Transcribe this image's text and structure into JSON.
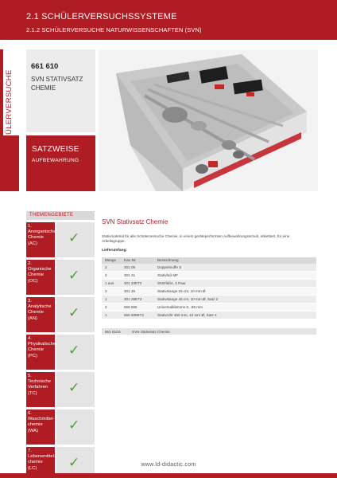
{
  "header": {
    "title": "2.1 SCHÜLERVERSUCHSSYSTEME",
    "subtitle": "2.1.2 SCHÜLERVERSUCHE NATURWISSENSCHAFTEN (SVN)"
  },
  "side_tab": {
    "label": "CHEMIE - SCHÜLERVERSUCHE"
  },
  "product": {
    "number": "661 610",
    "name": "SVN STATIVSATZ CHEMIE"
  },
  "set_box": {
    "title": "SATZWEISE",
    "subtitle": "AUFBEWAHRUNG"
  },
  "themes": {
    "header": "THEMENGEBIETE",
    "items": [
      {
        "label": "1.\nAnorganische\nChemie\n(AC)",
        "check": "✓"
      },
      {
        "label": "2.\nOrganische\nChemie\n(OC)",
        "check": "✓"
      },
      {
        "label": "3.\nAnalytische\nChemie\n(AN)",
        "check": "✓"
      },
      {
        "label": "4.\nPhysikalische\nChemie\n(PC)",
        "check": "✓"
      },
      {
        "label": "5.\nTechnische\nVerfahren\n(TC)",
        "check": "✓"
      },
      {
        "label": "6.\nWaschmittel-\nchemie\n(WA)",
        "check": "✓"
      },
      {
        "label": "7.\nLebensmittel-\nchemie\n(LC)",
        "check": "✓"
      }
    ]
  },
  "content": {
    "title": "SVN Stativsatz Chemie",
    "description": "Stativmaterial für alle Schülerversuche Chemie, in einem geräteperformten Aufbewahrungsschub, etikettiert, für eine Arbeitsgruppe.",
    "lieferumfang": "Lieferumfang:",
    "columns": [
      "Menge",
      "Kat.-Nr.",
      "Bezeichnung"
    ],
    "rows": [
      [
        "2",
        "301 09",
        "Doppelmuffe S"
      ],
      [
        "2",
        "301 21",
        "Stativfuß MF"
      ],
      [
        "1 aus",
        "301 23ET2",
        "Stützfüße, 2 Paar"
      ],
      [
        "2",
        "301 26",
        "Stativstange 25 cm, 10 mm Ø"
      ],
      [
        "1",
        "301 28ET2",
        "Stativstange 45 cm, 10 mm Ø, Satz 2"
      ],
      [
        "2",
        "666 555",
        "Universalklemme 0...80 mm"
      ],
      [
        "1",
        "666 609ET2",
        "Stativrohr 450 mm, 10 mm Ø, Satz 2"
      ]
    ],
    "order": {
      "number": "661 610S",
      "name": "SVN Stativsatz Chemie"
    }
  },
  "footer": {
    "url": "www.ld-didactic.com"
  },
  "colors": {
    "brand_red": "#b01c24",
    "check_green": "#46a235",
    "panel_gray": "#ececec"
  }
}
